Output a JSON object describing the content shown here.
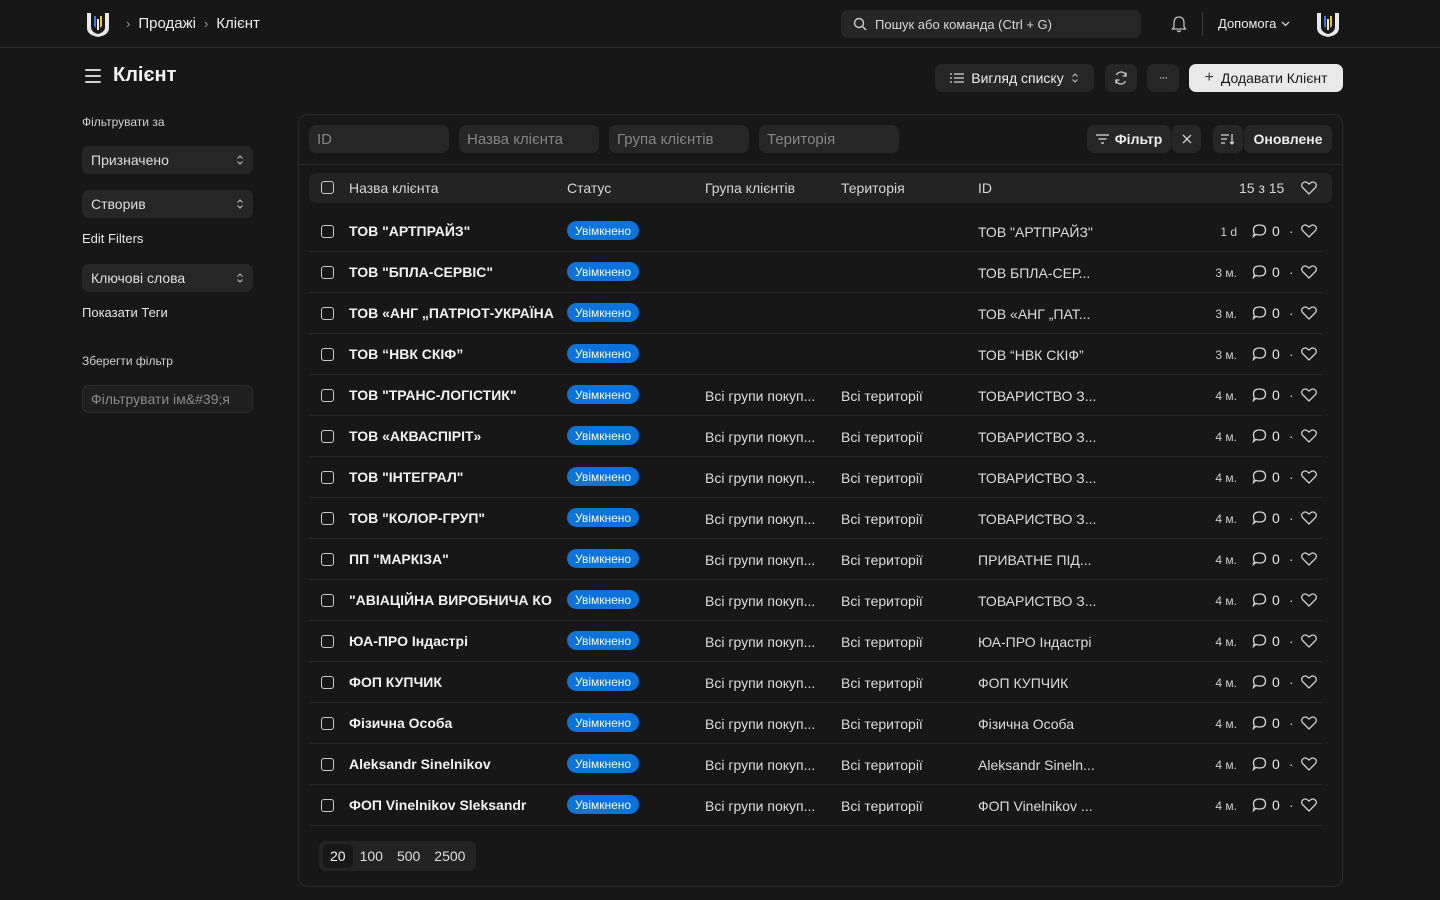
{
  "topbar": {
    "breadcrumbs": [
      "Продажі",
      "Клієнт"
    ],
    "search_placeholder": "Пошук або команда (Ctrl + G)",
    "help_label": "Допомога"
  },
  "page": {
    "title": "Клієнт",
    "view_label": "Вигляд списку",
    "more_label": "···",
    "add_label": "Додавати Клієнт"
  },
  "sidebar": {
    "filter_by_label": "Фільтрувати за",
    "assigned_label": "Призначено",
    "created_label": "Створив",
    "edit_filters_label": "Edit Filters",
    "tags_label": "Ключові слова",
    "show_tags_label": "Показати Теги",
    "save_filter_label": "Зберегти фільтр",
    "filter_name_placeholder": "Фільтрувати ім&#39;я"
  },
  "filters": {
    "id_placeholder": "ID",
    "name_placeholder": "Назва клієнта",
    "group_placeholder": "Група клієнтів",
    "territory_placeholder": "Територія",
    "filter_label": "Фільтр",
    "sort_label": "Оновлене"
  },
  "table": {
    "columns": {
      "name": "Назва клієнта",
      "status": "Статус",
      "group": "Група клієнтів",
      "territory": "Територія",
      "id": "ID"
    },
    "count": "15 з 15",
    "rows": [
      {
        "name": "ТОВ \"АРТПРАЙЗ\"",
        "status": "Увімкнено",
        "group": "",
        "territory": "",
        "id": "ТОВ \"АРТПРАЙЗ\"",
        "time": "1 d",
        "comments": "0"
      },
      {
        "name": "ТОВ \"БПЛА-СЕРВІС\"",
        "status": "Увімкнено",
        "group": "",
        "territory": "",
        "id": "ТОВ БПЛА-СЕР...",
        "time": "3 м.",
        "comments": "0"
      },
      {
        "name": "ТОВ «АНГ „ПАТРІОТ-УКРАЇНА",
        "status": "Увімкнено",
        "group": "",
        "territory": "",
        "id": "ТОВ «АНГ „ПАТ...",
        "time": "3 м.",
        "comments": "0"
      },
      {
        "name": "ТОВ “НВК СКІФ”",
        "status": "Увімкнено",
        "group": "",
        "territory": "",
        "id": "ТОВ “НВК СКІФ”",
        "time": "3 м.",
        "comments": "0"
      },
      {
        "name": "ТОВ \"ТРАНС-ЛОГІСТИК\"",
        "status": "Увімкнено",
        "group": "Всі групи покуп...",
        "territory": "Всі території",
        "id": "ТОВАРИСТВО З...",
        "time": "4 м.",
        "comments": "0"
      },
      {
        "name": "ТОВ «АКВАСПІРІТ»",
        "status": "Увімкнено",
        "group": "Всі групи покуп...",
        "territory": "Всі території",
        "id": "ТОВАРИСТВО З...",
        "time": "4 м.",
        "comments": "0"
      },
      {
        "name": "ТОВ \"ІНТЕГРАЛ\"",
        "status": "Увімкнено",
        "group": "Всі групи покуп...",
        "territory": "Всі території",
        "id": "ТОВАРИСТВО З...",
        "time": "4 м.",
        "comments": "0"
      },
      {
        "name": "ТОВ \"КОЛОР-ГРУП\"",
        "status": "Увімкнено",
        "group": "Всі групи покуп...",
        "territory": "Всі території",
        "id": "ТОВАРИСТВО З...",
        "time": "4 м.",
        "comments": "0"
      },
      {
        "name": "ПП \"МАРКІЗА\"",
        "status": "Увімкнено",
        "group": "Всі групи покуп...",
        "territory": "Всі території",
        "id": "ПРИВАТНЕ ПІД...",
        "time": "4 м.",
        "comments": "0"
      },
      {
        "name": "\"АВІАЦІЙНА ВИРОБНИЧА КО",
        "status": "Увімкнено",
        "group": "Всі групи покуп...",
        "territory": "Всі території",
        "id": "ТОВАРИСТВО З...",
        "time": "4 м.",
        "comments": "0"
      },
      {
        "name": "ЮА-ПРО Індастрі",
        "status": "Увімкнено",
        "group": "Всі групи покуп...",
        "territory": "Всі території",
        "id": "ЮА-ПРО Індастрі",
        "time": "4 м.",
        "comments": "0"
      },
      {
        "name": "ФОП КУПЧИК",
        "status": "Увімкнено",
        "group": "Всі групи покуп...",
        "territory": "Всі території",
        "id": "ФОП КУПЧИК",
        "time": "4 м.",
        "comments": "0"
      },
      {
        "name": "Фізична Особа",
        "status": "Увімкнено",
        "group": "Всі групи покуп...",
        "territory": "Всі території",
        "id": "Фізична Особа",
        "time": "4 м.",
        "comments": "0"
      },
      {
        "name": "Aleksandr Sinelnikov",
        "status": "Увімкнено",
        "group": "Всі групи покуп...",
        "territory": "Всі території",
        "id": "Aleksandr Sineln...",
        "time": "4 м.",
        "comments": "0"
      },
      {
        "name": "ФОП Vinelnikov Sleksandr",
        "status": "Увімкнено",
        "group": "Всі групи покуп...",
        "territory": "Всі території",
        "id": "ФОП Vinelnikov ...",
        "time": "4 м.",
        "comments": "0"
      }
    ]
  },
  "pager": {
    "sizes": [
      "20",
      "100",
      "500",
      "2500"
    ],
    "active": "20"
  },
  "colors": {
    "background": "#171717",
    "surface": "#262626",
    "badge": "#0b73d9",
    "primary_button": "#e9e9e9"
  }
}
